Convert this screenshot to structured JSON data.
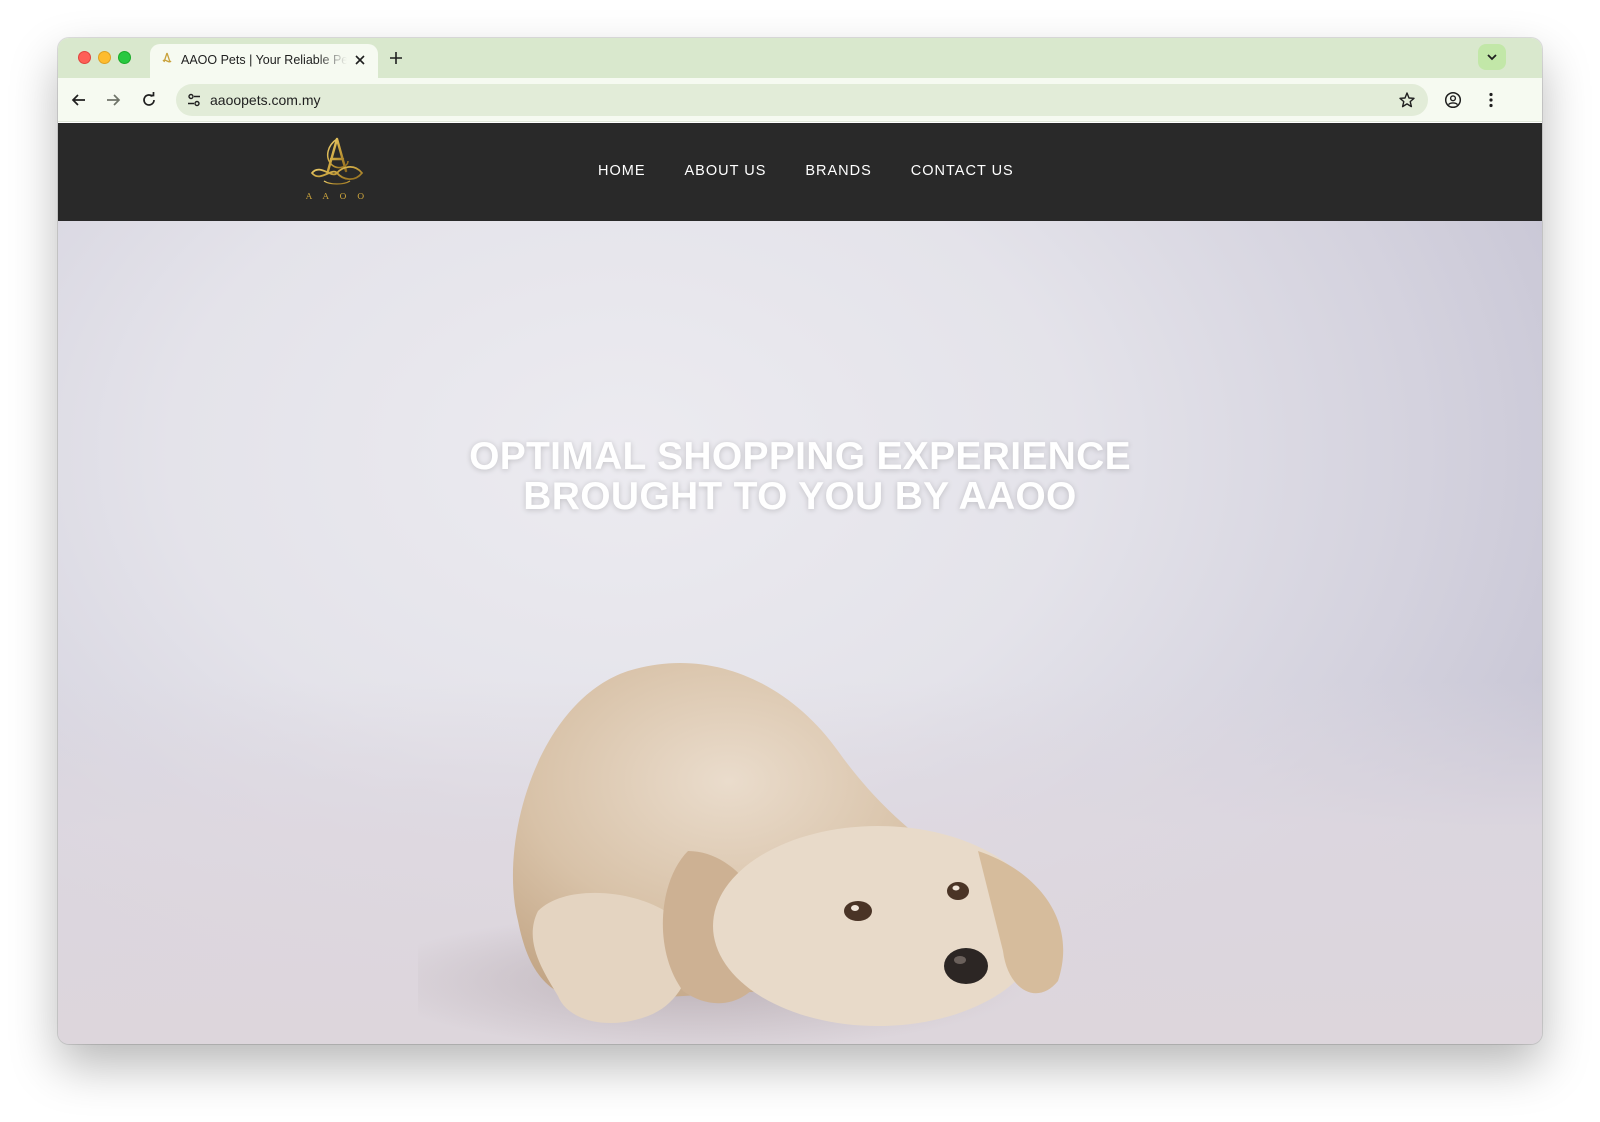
{
  "browser": {
    "tab_title": "AAOO Pets | Your Reliable Pet Partner",
    "url": "aaoopets.com.my"
  },
  "site": {
    "logo_text": "AAOO",
    "nav": [
      {
        "label": "HOME"
      },
      {
        "label": "ABOUT US"
      },
      {
        "label": "BRANDS"
      },
      {
        "label": "CONTACT US"
      }
    ]
  },
  "hero": {
    "headline_line1": "OPTIMAL SHOPPING EXPERIENCE",
    "headline_line2": "BROUGHT TO YOU BY AAOO"
  },
  "colors": {
    "tabstrip": "#d9e8cd",
    "toolbar": "#f6faf1",
    "header": "#292929",
    "logo_gold": "#c9a23c",
    "hero_background": "#e4e3ea"
  },
  "icons": {
    "back": "arrow-left-icon",
    "forward": "arrow-right-icon",
    "reload": "reload-icon",
    "site_info": "tune-icon",
    "bookmark": "star-icon",
    "profile": "account-circle-icon",
    "menu": "kebab-menu-icon",
    "tab_close": "close-icon",
    "new_tab": "plus-icon",
    "tab_search": "chevron-down-icon"
  }
}
